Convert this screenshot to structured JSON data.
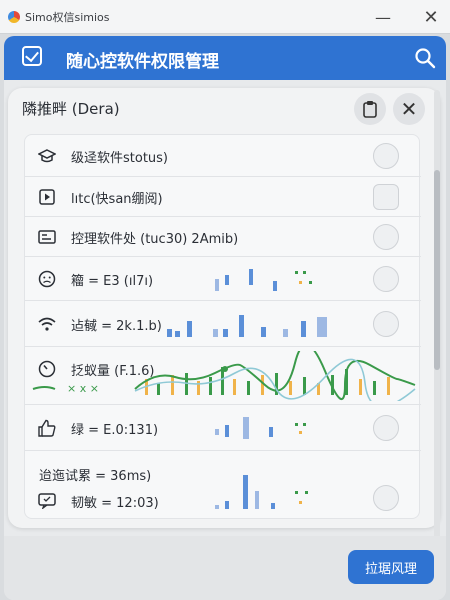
{
  "window": {
    "title": "Simo权信simios"
  },
  "header": {
    "title": "随心控软件权限管理"
  },
  "panel": {
    "title": "隣推畔 (Dera)"
  },
  "rows": [
    {
      "icon": "graduation-cap-icon",
      "label": "级迳软件stotus)"
    },
    {
      "icon": "play-square-icon",
      "label": "lıtc(快san绷阅)"
    },
    {
      "icon": "terminal-card-icon",
      "label": "控理软件处 (tuc30) 2Amib)"
    },
    {
      "icon": "face-icon",
      "label": "籕 = E3 (ıl7ı)"
    },
    {
      "icon": "wifi-icon",
      "label": "迠戫 = 2k.1.b)"
    },
    {
      "icon": "gauge-icon",
      "label": "抸蚁量 (F.1.6)"
    },
    {
      "icon": "thumbs-up-icon",
      "label": "绿 = E.0:131)"
    },
    {
      "icon": "clock-icon",
      "label": "迨迤试累 = 36ms)"
    },
    {
      "icon": "message-icon",
      "label": "韧敏 = 12:03)"
    }
  ],
  "legend_marks": "× x ×",
  "action_button": {
    "label": "拉琚风理"
  },
  "colors": {
    "accent": "#2f73d2",
    "bar_blue": "#5b8fd8",
    "bar_orange": "#f0b34a",
    "line_green": "#3a9a4a"
  }
}
